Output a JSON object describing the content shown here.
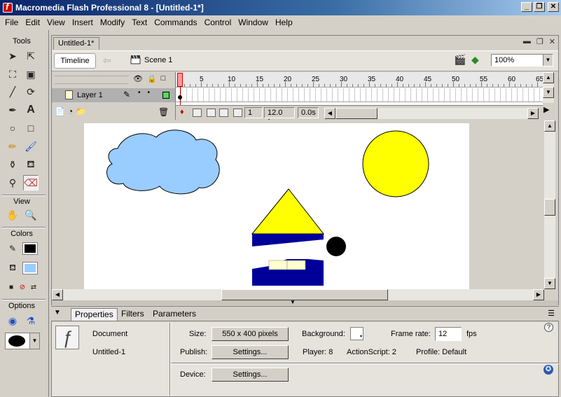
{
  "window": {
    "title": "Macromedia Flash Professional 8 - [Untitled-1*]"
  },
  "menu": [
    "File",
    "Edit",
    "View",
    "Insert",
    "Modify",
    "Text",
    "Commands",
    "Control",
    "Window",
    "Help"
  ],
  "tools": {
    "tools_label": "Tools",
    "view_label": "View",
    "colors_label": "Colors",
    "options_label": "Options",
    "stroke_color": "#000000",
    "fill_color": "#99ccff"
  },
  "document": {
    "tab_label": "Untitled-1*",
    "timeline_button": "Timeline",
    "scene_label": "Scene 1",
    "zoom": "100%"
  },
  "timeline": {
    "layer_name": "Layer 1",
    "ruler_numbers": [
      "1",
      "5",
      "10",
      "15",
      "20",
      "25",
      "30",
      "35",
      "40",
      "45",
      "50",
      "55",
      "60",
      "65"
    ],
    "current_frame": "1",
    "frame_rate": "12.0 fps",
    "elapsed": "0.0s"
  },
  "stage": {
    "colors": {
      "cloud": "#99ccff",
      "sun": "#ffff00",
      "triangle": "#ffff00",
      "house": "#000099",
      "ball": "#000000",
      "windows": "#ffffcc"
    }
  },
  "properties": {
    "tabs": [
      "Properties",
      "Filters",
      "Parameters"
    ],
    "doc_label": "Document",
    "doc_name": "Untitled-1",
    "size_label": "Size:",
    "size_value": "550 x 400 pixels",
    "publish_label": "Publish:",
    "settings_label": "Settings...",
    "device_label": "Device:",
    "device_settings_label": "Settings...",
    "background_label": "Background:",
    "frame_rate_label": "Frame rate:",
    "frame_rate_value": "12",
    "fps_label": "fps",
    "player": "Player: 8",
    "actionscript": "ActionScript:  2",
    "profile": "Profile:  Default",
    "help": "?"
  }
}
